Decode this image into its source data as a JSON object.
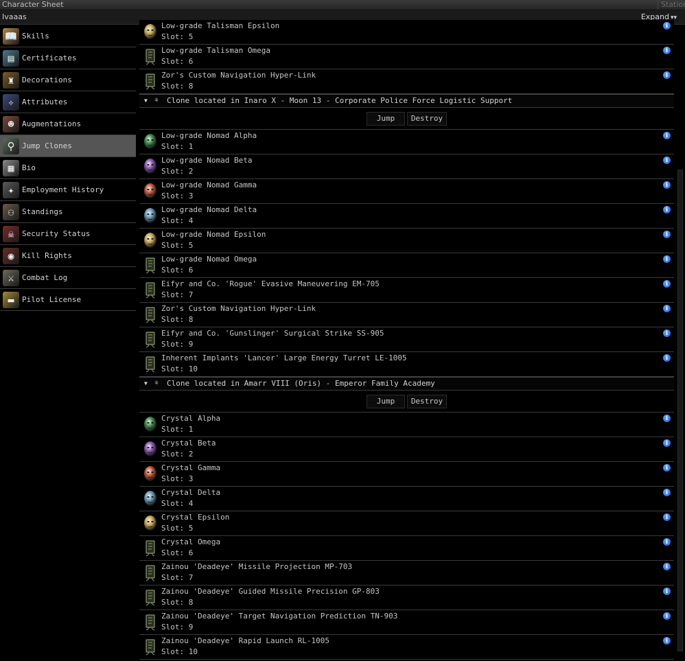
{
  "window": {
    "title": "Character Sheet",
    "station_tab": "Station",
    "character_name": "Ivaaas",
    "expand_label": "Expand"
  },
  "sidebar": {
    "items": [
      {
        "label": "Skills",
        "icon": "book-icon",
        "color": "#b08a4a",
        "glyph": "📖"
      },
      {
        "label": "Certificates",
        "icon": "certificate-icon",
        "color": "#4a7a8a",
        "glyph": "▤"
      },
      {
        "label": "Decorations",
        "icon": "medal-icon",
        "color": "#7a5a2a",
        "glyph": "♜"
      },
      {
        "label": "Attributes",
        "icon": "attributes-icon",
        "color": "#3a4a7a",
        "glyph": "✧"
      },
      {
        "label": "Augmentations",
        "icon": "augmentation-head-icon",
        "color": "#7a4a3a",
        "glyph": "☻"
      },
      {
        "label": "Jump Clones",
        "icon": "jump-clone-icon",
        "color": "#5a6a5a",
        "glyph": "⚲"
      },
      {
        "label": "Bio",
        "icon": "bio-document-icon",
        "color": "#8a8a8a",
        "glyph": "▦"
      },
      {
        "label": "Employment History",
        "icon": "employment-stars-icon",
        "color": "#5a5a5a",
        "glyph": "✦"
      },
      {
        "label": "Standings",
        "icon": "standings-people-icon",
        "color": "#6a5a4a",
        "glyph": "⚇"
      },
      {
        "label": "Security Status",
        "icon": "skull-crossbones-icon",
        "color": "#7a2a2a",
        "glyph": "☠"
      },
      {
        "label": "Kill Rights",
        "icon": "kill-rights-target-icon",
        "color": "#6a2a2a",
        "glyph": "◉"
      },
      {
        "label": "Combat Log",
        "icon": "crossed-swords-icon",
        "color": "#6a6a5a",
        "glyph": "⚔"
      },
      {
        "label": "Pilot License",
        "icon": "pilot-license-icon",
        "color": "#a08a3a",
        "glyph": "▬"
      }
    ],
    "active_index": 5
  },
  "clones": {
    "top_partial": [
      {
        "name": "Low-grade Talisman Epsilon",
        "slot": "Slot: 5",
        "icon": "face-gold"
      },
      {
        "name": "Low-grade Talisman Omega",
        "slot": "Slot: 6",
        "icon": "chip"
      },
      {
        "name": "Zor's Custom Navigation Hyper-Link",
        "slot": "Slot: 8",
        "icon": "chip"
      }
    ],
    "sections": [
      {
        "header": "Clone located in Inaro X - Moon 13 - Corporate Police Force Logistic Support",
        "jump_label": "Jump",
        "destroy_label": "Destroy",
        "implants": [
          {
            "name": "Low-grade Nomad Alpha",
            "slot": "Slot: 1",
            "icon": "face-green"
          },
          {
            "name": "Low-grade Nomad Beta",
            "slot": "Slot: 2",
            "icon": "face-purple"
          },
          {
            "name": "Low-grade Nomad Gamma",
            "slot": "Slot: 3",
            "icon": "face-red"
          },
          {
            "name": "Low-grade Nomad Delta",
            "slot": "Slot: 4",
            "icon": "face-blue"
          },
          {
            "name": "Low-grade Nomad Epsilon",
            "slot": "Slot: 5",
            "icon": "face-gold"
          },
          {
            "name": "Low-grade Nomad Omega",
            "slot": "Slot: 6",
            "icon": "chip"
          },
          {
            "name": "Eifyr and Co. 'Rogue' Evasive Maneuvering EM-705",
            "slot": "Slot: 7",
            "icon": "chip"
          },
          {
            "name": "Zor's Custom Navigation Hyper-Link",
            "slot": "Slot: 8",
            "icon": "chip"
          },
          {
            "name": "Eifyr and Co. 'Gunslinger' Surgical Strike SS-905",
            "slot": "Slot: 9",
            "icon": "chip"
          },
          {
            "name": "Inherent Implants 'Lancer' Large Energy Turret LE-1005",
            "slot": "Slot: 10",
            "icon": "chip"
          }
        ]
      },
      {
        "header": "Clone located in Amarr VIII (Oris) - Emperor Family Academy",
        "jump_label": "Jump",
        "destroy_label": "Destroy",
        "implants": [
          {
            "name": "Crystal Alpha",
            "slot": "Slot: 1",
            "icon": "face-green"
          },
          {
            "name": "Crystal Beta",
            "slot": "Slot: 2",
            "icon": "face-purple"
          },
          {
            "name": "Crystal Gamma",
            "slot": "Slot: 3",
            "icon": "face-red"
          },
          {
            "name": "Crystal Delta",
            "slot": "Slot: 4",
            "icon": "face-blue"
          },
          {
            "name": "Crystal Epsilon",
            "slot": "Slot: 5",
            "icon": "face-gold"
          },
          {
            "name": "Crystal Omega",
            "slot": "Slot: 6",
            "icon": "chip"
          },
          {
            "name": "Zainou 'Deadeye' Missile Projection MP-703",
            "slot": "Slot: 7",
            "icon": "chip"
          },
          {
            "name": "Zainou 'Deadeye' Guided Missile Precision GP-803",
            "slot": "Slot: 8",
            "icon": "chip"
          },
          {
            "name": "Zainou 'Deadeye' Target Navigation Prediction TN-903",
            "slot": "Slot: 9",
            "icon": "chip"
          },
          {
            "name": "Zainou 'Deadeye' Rapid Launch RL-1005",
            "slot": "Slot: 10",
            "icon": "chip"
          }
        ]
      }
    ]
  },
  "colors": {
    "face-green": "#3f8a4a",
    "face-purple": "#8a5ab0",
    "face-red": "#c0583a",
    "face-blue": "#6a9ab8",
    "face-gold": "#c8a85a",
    "chip": "#8a9a6a",
    "info": "#2a6ae0",
    "active-nav": "#555555"
  }
}
